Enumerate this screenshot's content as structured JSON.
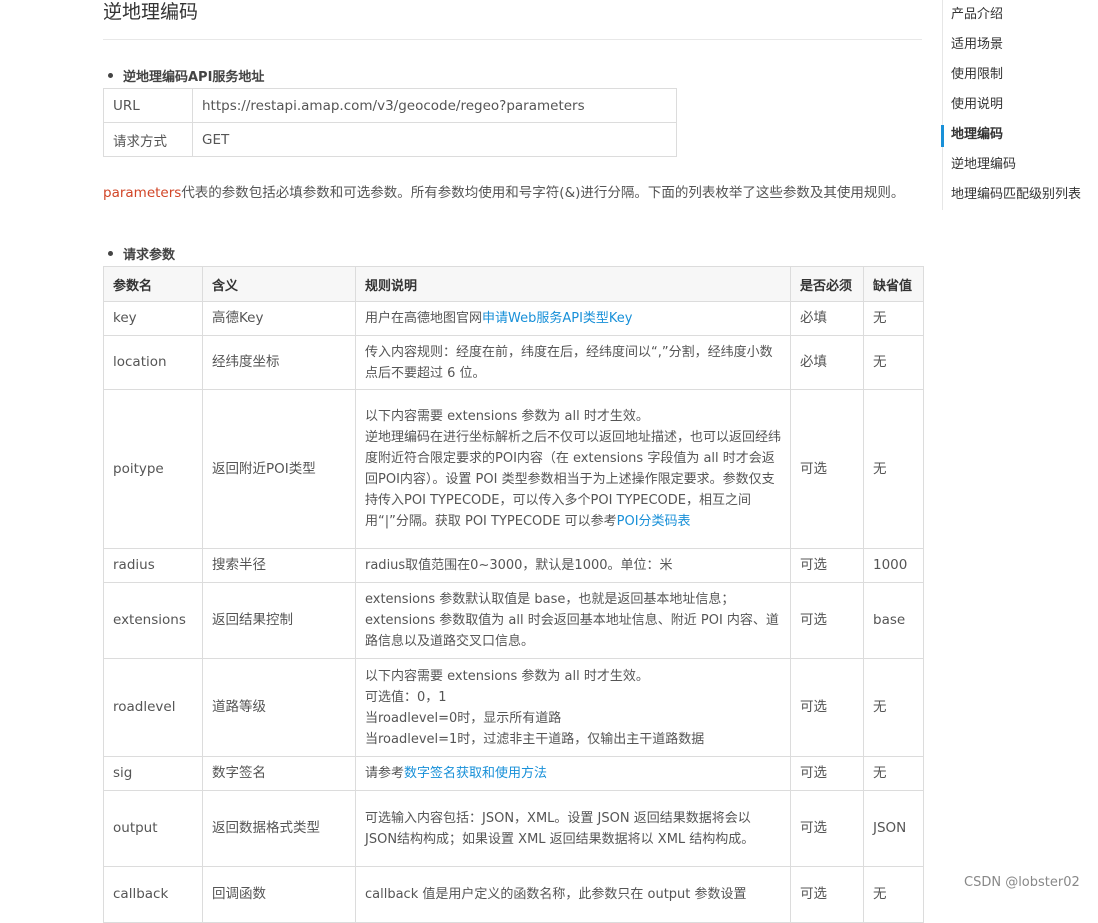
{
  "page": {
    "title": "逆地理编码",
    "section1_heading": "逆地理编码API服务地址",
    "section2_heading": "请求参数"
  },
  "service_table": {
    "rows": [
      {
        "key": "URL",
        "value": "https://restapi.amap.com/v3/geocode/regeo?parameters"
      },
      {
        "key": "请求方式",
        "value": "GET"
      }
    ]
  },
  "intro": {
    "highlight": "parameters",
    "text": "代表的参数包括必填参数和可选参数。所有参数均使用和号字符(&)进行分隔。下面的列表枚举了这些参数及其使用规则。"
  },
  "params_table": {
    "headers": [
      "参数名",
      "含义",
      "规则说明",
      "是否必须",
      "缺省值"
    ],
    "rows": [
      {
        "name": "key",
        "meaning": "高德Key",
        "rule_prefix": "用户在高德地图官网",
        "rule_link": "申请Web服务API类型Key",
        "required": "必填",
        "default": "无"
      },
      {
        "name": "location",
        "meaning": "经纬度坐标",
        "rule": "传入内容规则：经度在前，纬度在后，经纬度间以“,”分割，经纬度小数点后不要超过 6 位。",
        "required": "必填",
        "default": "无"
      },
      {
        "name": "poitype",
        "meaning": "返回附近POI类型",
        "rule_line1": "以下内容需要 extensions 参数为 all 时才生效。",
        "rule_line2": "逆地理编码在进行坐标解析之后不仅可以返回地址描述，也可以返回经纬度附近符合限定要求的POI内容（在 extensions 字段值为 all 时才会返回POI内容）。设置 POI 类型参数相当于为上述操作限定要求。参数仅支持传入POI TYPECODE，可以传入多个POI TYPECODE，相互之间用“|”分隔。获取 POI TYPECODE 可以参考",
        "rule_link": "POI分类码表",
        "required": "可选",
        "default": "无"
      },
      {
        "name": "radius",
        "meaning": "搜索半径",
        "rule": "radius取值范围在0~3000，默认是1000。单位：米",
        "required": "可选",
        "default": "1000"
      },
      {
        "name": "extensions",
        "meaning": "返回结果控制",
        "rule_line1": "extensions 参数默认取值是 base，也就是返回基本地址信息；",
        "rule_line2": "extensions 参数取值为 all 时会返回基本地址信息、附近 POI 内容、道路信息以及道路交叉口信息。",
        "required": "可选",
        "default": "base"
      },
      {
        "name": "roadlevel",
        "meaning": "道路等级",
        "rule_line1": "以下内容需要 extensions 参数为 all 时才生效。",
        "rule_line2": "可选值：0，1",
        "rule_line3": "当roadlevel=0时，显示所有道路",
        "rule_line4": "当roadlevel=1时，过滤非主干道路，仅输出主干道路数据",
        "required": "可选",
        "default": "无"
      },
      {
        "name": "sig",
        "meaning": "数字签名",
        "rule_prefix": "请参考",
        "rule_link": "数字签名获取和使用方法",
        "required": "可选",
        "default": "无"
      },
      {
        "name": "output",
        "meaning": "返回数据格式类型",
        "rule": "可选输入内容包括：JSON，XML。设置 JSON 返回结果数据将会以JSON结构构成；如果设置 XML 返回结果数据将以 XML 结构构成。",
        "required": "可选",
        "default": "JSON"
      },
      {
        "name": "callback",
        "meaning": "回调函数",
        "rule": "callback 值是用户定义的函数名称，此参数只在 output 参数设置",
        "required": "可选",
        "default": "无"
      }
    ]
  },
  "toc": {
    "items": [
      "产品介绍",
      "适用场景",
      "使用限制",
      "使用说明",
      "地理编码",
      "逆地理编码",
      "地理编码匹配级别列表"
    ],
    "active_index": 4
  },
  "watermark": "CSDN @lobster02",
  "colors": {
    "link": "#1890d8",
    "highlight": "#d14527",
    "active_marker": "#1890d8"
  }
}
